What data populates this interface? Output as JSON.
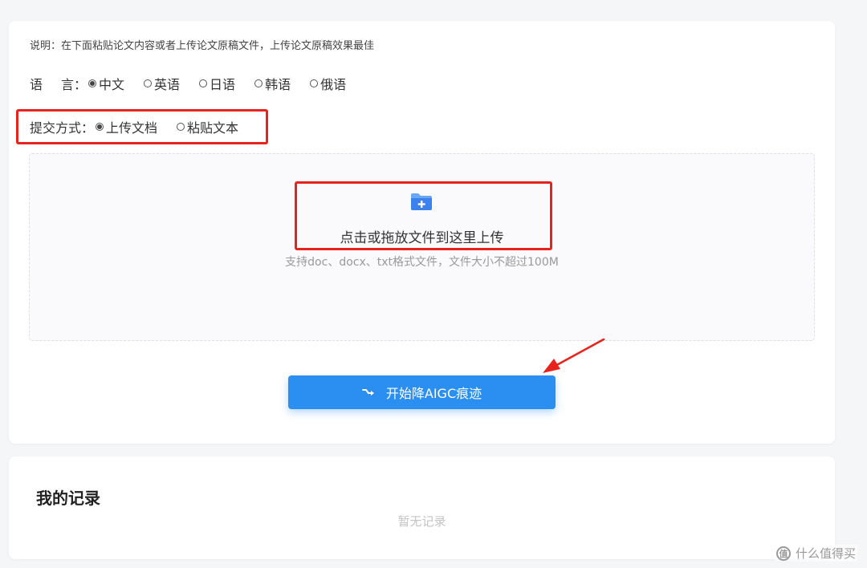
{
  "form": {
    "description": "说明：在下面粘贴论文内容或者上传论文原稿文件，上传论文原稿效果最佳",
    "language": {
      "label": "语    言",
      "options": [
        "中文",
        "英语",
        "日语",
        "韩语",
        "俄语"
      ],
      "selected": "中文"
    },
    "submit_method": {
      "label": "提交方式",
      "options": [
        "上传文档",
        "粘贴文本"
      ],
      "selected": "上传文档"
    },
    "colon": "："
  },
  "upload": {
    "icon": "folder-plus-icon",
    "main_text": "点击或拖放文件到这里上传",
    "hint": "支持doc、docx、txt格式文件，文件大小不超过100M"
  },
  "action": {
    "start_label": "开始降AIGC痕迹",
    "icon": "wand-icon"
  },
  "records": {
    "title": "我的记录",
    "empty": "暂无记录"
  },
  "watermark": {
    "icon_char": "值",
    "text": "什么值得买"
  },
  "colors": {
    "primary": "#2a8ff0",
    "annotation_red": "#e8231e",
    "background": "#f5f6f8"
  }
}
